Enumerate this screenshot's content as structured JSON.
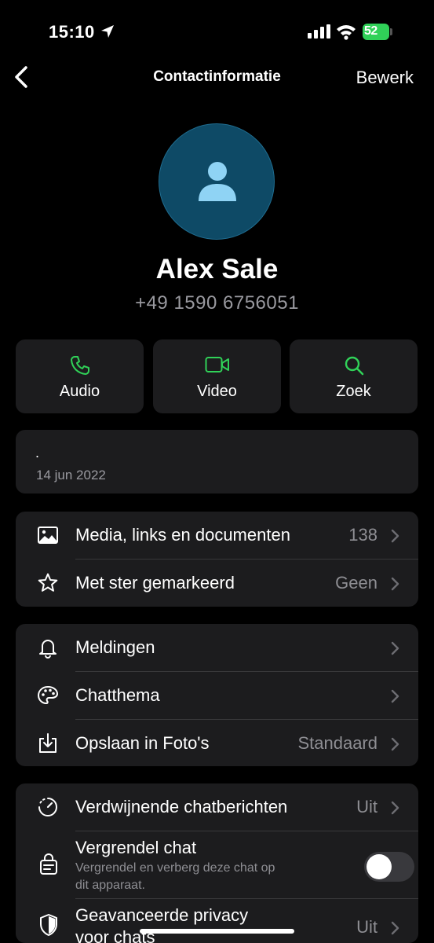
{
  "status_bar": {
    "time": "15:10",
    "battery": "52"
  },
  "nav": {
    "title": "Contactinformatie",
    "edit_label": "Bewerk"
  },
  "contact": {
    "name": "Alex Sale",
    "phone": "+49 1590 6756051"
  },
  "actions": [
    {
      "label": "Audio",
      "icon": "phone-icon"
    },
    {
      "label": "Video",
      "icon": "video-icon"
    },
    {
      "label": "Zoek",
      "icon": "search-icon"
    }
  ],
  "about": {
    "text": ".",
    "date": "14 jun 2022"
  },
  "group1": [
    {
      "label": "Media, links en documenten",
      "value": "138",
      "icon": "image-icon"
    },
    {
      "label": "Met ster gemarkeerd",
      "value": "Geen",
      "icon": "star-icon"
    }
  ],
  "group2": [
    {
      "label": "Meldingen",
      "value": "",
      "icon": "bell-icon"
    },
    {
      "label": "Chatthema",
      "value": "",
      "icon": "palette-icon"
    },
    {
      "label": "Opslaan in Foto's",
      "value": "Standaard",
      "icon": "save-icon"
    }
  ],
  "group3": {
    "disappearing": {
      "label": "Verdwijnende chatberichten",
      "value": "Uit"
    },
    "lock": {
      "label": "Vergrendel chat",
      "sub1": "Vergrendel en verberg deze chat op",
      "sub2": "dit apparaat.",
      "enabled": false
    },
    "privacy": {
      "label1": "Geavanceerde privacy",
      "label2": "voor chats",
      "value": "Uit"
    }
  },
  "colors": {
    "accent": "#30d158",
    "card": "#1c1c1e",
    "avatar": "#0e4a66"
  }
}
